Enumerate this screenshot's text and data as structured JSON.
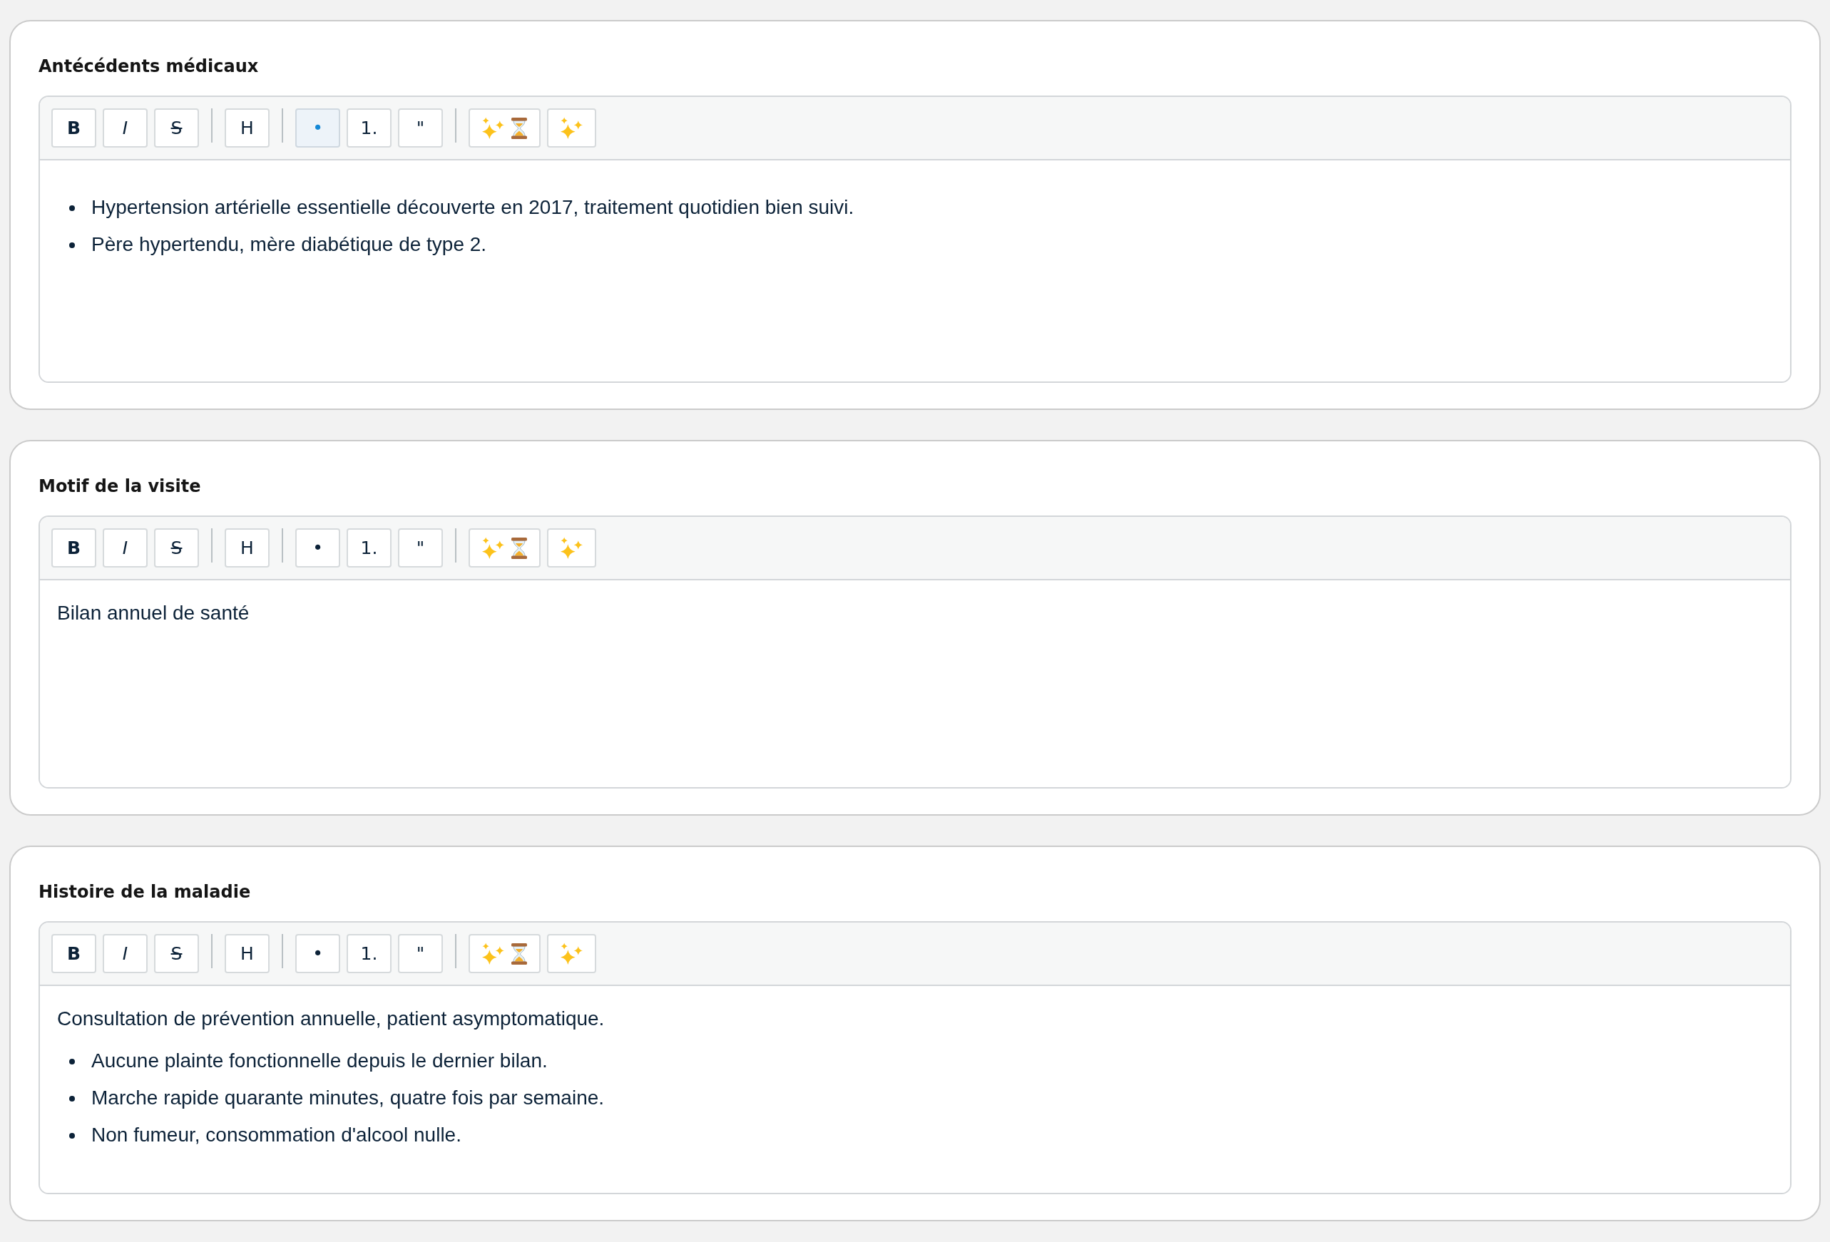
{
  "sections": [
    {
      "title": "Antécédents médicaux",
      "toolbar": [
        {
          "kind": "bold",
          "label": "B",
          "on": false
        },
        {
          "kind": "italic",
          "label": "I",
          "on": false
        },
        {
          "kind": "strike",
          "label": "S",
          "on": false
        },
        {
          "kind": "separator"
        },
        {
          "kind": "heading",
          "label": "H",
          "on": false
        },
        {
          "kind": "separator"
        },
        {
          "kind": "bullet-list",
          "label": "•",
          "on": true
        },
        {
          "kind": "numbered-list",
          "label": "1.",
          "on": false
        },
        {
          "kind": "quote",
          "label": "\"",
          "on": false
        },
        {
          "kind": "separator"
        },
        {
          "kind": "ai-pending"
        },
        {
          "kind": "ai"
        }
      ],
      "content": [
        {
          "kind": "list",
          "items": [
            "Hypertension artérielle essentielle découverte en 2017, traitement quotidien bien suivi.",
            "Père hypertendu, mère diabétique de type 2."
          ]
        }
      ]
    },
    {
      "title": "Motif de la visite",
      "toolbar": [
        {
          "kind": "bold",
          "label": "B",
          "on": false
        },
        {
          "kind": "italic",
          "label": "I",
          "on": false
        },
        {
          "kind": "strike",
          "label": "S",
          "on": false
        },
        {
          "kind": "separator"
        },
        {
          "kind": "heading",
          "label": "H",
          "on": false
        },
        {
          "kind": "separator"
        },
        {
          "kind": "bullet-list",
          "label": "•",
          "on": false
        },
        {
          "kind": "numbered-list",
          "label": "1.",
          "on": false
        },
        {
          "kind": "quote",
          "label": "\"",
          "on": false
        },
        {
          "kind": "separator"
        },
        {
          "kind": "ai-pending"
        },
        {
          "kind": "ai"
        }
      ],
      "content": [
        {
          "kind": "paragraph",
          "text": "Bilan annuel de santé"
        }
      ]
    },
    {
      "title": "Histoire de la maladie",
      "toolbar": [
        {
          "kind": "bold",
          "label": "B",
          "on": false
        },
        {
          "kind": "italic",
          "label": "I",
          "on": false
        },
        {
          "kind": "strike",
          "label": "S",
          "on": false
        },
        {
          "kind": "separator"
        },
        {
          "kind": "heading",
          "label": "H",
          "on": false
        },
        {
          "kind": "separator"
        },
        {
          "kind": "bullet-list",
          "label": "•",
          "on": false
        },
        {
          "kind": "numbered-list",
          "label": "1.",
          "on": false
        },
        {
          "kind": "quote",
          "label": "\"",
          "on": false
        },
        {
          "kind": "separator"
        },
        {
          "kind": "ai-pending"
        },
        {
          "kind": "ai"
        }
      ],
      "content": [
        {
          "kind": "paragraph",
          "text": "Consultation de prévention annuelle, patient asymptomatique."
        },
        {
          "kind": "list",
          "items": [
            "Aucune plainte fonctionnelle depuis le dernier bilan.",
            "Marche rapide quarante minutes, quatre fois par semaine.",
            "Non fumeur, consommation d'alcool nulle."
          ]
        }
      ]
    }
  ]
}
